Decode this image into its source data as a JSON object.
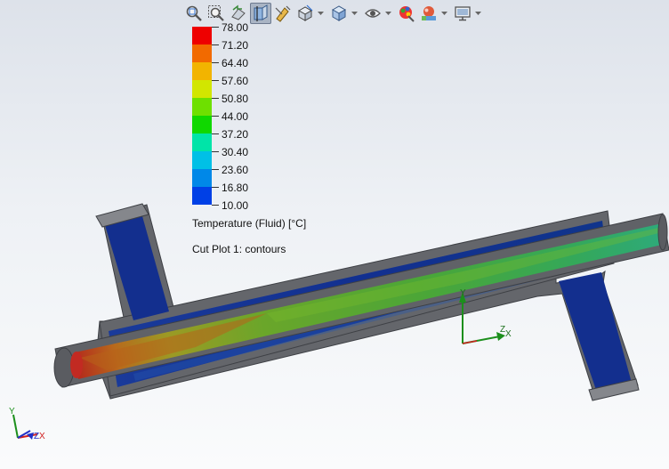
{
  "toolbar": {
    "buttons": [
      {
        "icon": "zoom-to-fit-icon",
        "active": false
      },
      {
        "icon": "zoom-to-area-icon",
        "active": false
      },
      {
        "icon": "previous-view-icon",
        "active": false
      },
      {
        "icon": "section-view-icon",
        "active": true
      },
      {
        "icon": "dynamic-annotation-icon",
        "active": false
      },
      {
        "icon": "view-orientation-icon",
        "active": false,
        "dropdown": true
      },
      {
        "icon": "display-style-icon",
        "active": false,
        "dropdown": true
      },
      {
        "icon": "hide-show-items-icon",
        "active": false,
        "dropdown": true
      },
      {
        "icon": "edit-appearance-icon",
        "active": false
      },
      {
        "icon": "apply-scene-icon",
        "active": false,
        "dropdown": true
      },
      {
        "icon": "view-settings-icon",
        "active": false,
        "dropdown": true
      }
    ]
  },
  "legend": {
    "values": [
      "78.00",
      "71.20",
      "64.40",
      "57.60",
      "50.80",
      "44.00",
      "37.20",
      "30.40",
      "23.60",
      "16.80",
      "10.00"
    ],
    "colors": [
      "#ee0000",
      "#f26a00",
      "#f2b400",
      "#d2e600",
      "#6ee000",
      "#10d800",
      "#00e4a8",
      "#00c0e6",
      "#0088e8",
      "#0040e6"
    ],
    "title": "Temperature (Fluid) [°C]",
    "plot_label": "Cut Plot 1: contours"
  },
  "triads": {
    "model": {
      "x": "X",
      "y": "Y",
      "z": "Z"
    },
    "corner": {
      "x": "X",
      "y": "Y",
      "z": "Z"
    }
  },
  "colors": {
    "background_top": "#dde2ea",
    "background_bottom": "#fafbfc",
    "pipe_wall": "#6b6d72",
    "outer_fluid": "#0e2a8a",
    "inner_fluid": "#58a830",
    "hot_end": "#c81e1e"
  }
}
